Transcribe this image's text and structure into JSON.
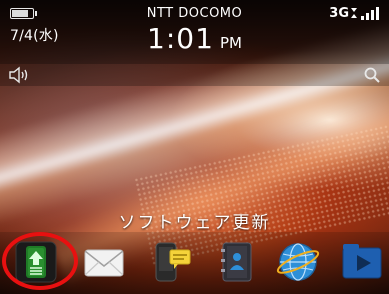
{
  "status_bar": {
    "date": "7/4(水)",
    "carrier": "NTT DOCOMO",
    "time": "1:01",
    "ampm": "PM",
    "network": "3G"
  },
  "icons": {
    "battery": "battery-icon",
    "signal": "signal-bars-icon",
    "volume": "volume-icon",
    "search": "search-icon"
  },
  "app_label": "ソフトウェア更新",
  "dock_apps": [
    {
      "name": "software-update",
      "icon": "update-arrow-icon"
    },
    {
      "name": "messages",
      "icon": "envelope-icon"
    },
    {
      "name": "messenger",
      "icon": "chat-phone-icon"
    },
    {
      "name": "contacts",
      "icon": "address-book-icon"
    },
    {
      "name": "browser",
      "icon": "globe-icon"
    },
    {
      "name": "media",
      "icon": "media-play-icon"
    }
  ],
  "colors": {
    "highlight_ring": "#e81010",
    "update_icon": "#2a8f2f",
    "browser_icon": "#2e8fd8",
    "media_icon": "#1e5fb0"
  }
}
